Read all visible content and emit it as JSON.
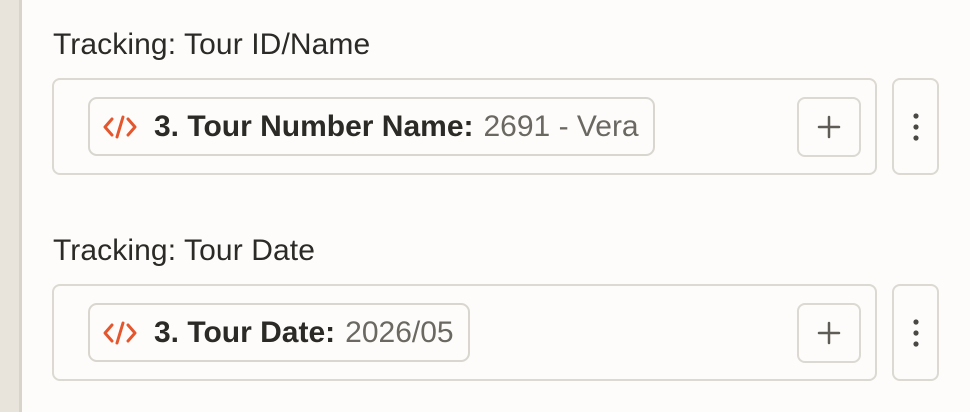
{
  "fields": [
    {
      "label": "Tracking: Tour ID/Name",
      "token": {
        "key": "3. Tour Number Name:",
        "value": "2691 - Vera"
      }
    },
    {
      "label": "Tracking: Tour Date",
      "token": {
        "key": "3. Tour Date:",
        "value": "2026/05"
      }
    }
  ],
  "icons": {
    "token": "code-icon",
    "add": "plus-icon",
    "more": "kebab-menu-icon"
  },
  "colors": {
    "token_icon": "#e4572e",
    "border": "#dcd9d2",
    "text": "#2b2a27",
    "muted_text": "#6b6862"
  }
}
